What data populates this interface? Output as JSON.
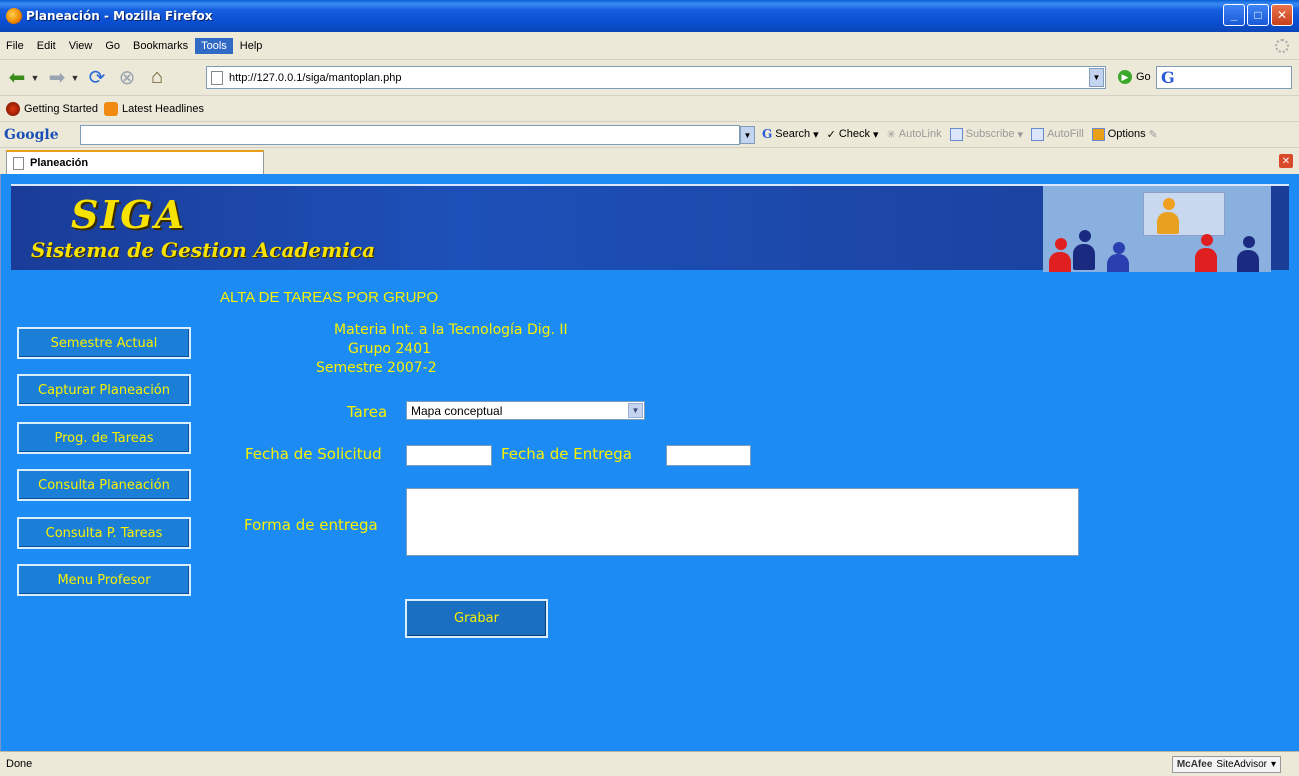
{
  "window": {
    "title": "Planeación - Mozilla Firefox"
  },
  "menubar": {
    "items": [
      "File",
      "Edit",
      "View",
      "Go",
      "Bookmarks",
      "Tools",
      "Help"
    ]
  },
  "navbar": {
    "url": "http://127.0.0.1/siga/mantoplan.php",
    "go_label": "Go"
  },
  "bookmarks": {
    "items": [
      "Getting Started",
      "Latest Headlines"
    ]
  },
  "googlebar": {
    "logo": "Google",
    "tools": [
      "Search",
      "Check",
      "AutoLink",
      "Subscribe",
      "AutoFill",
      "Options"
    ]
  },
  "tab": {
    "label": "Planeación"
  },
  "banner": {
    "logo": "SIGA",
    "subtitle": "Sistema de Gestion Academica"
  },
  "page": {
    "heading": "ALTA DE TAREAS POR GRUPO",
    "materia": "Materia Int. a la Tecnología Dig. II",
    "grupo": "Grupo 2401",
    "semestre": "Semestre 2007-2"
  },
  "sidebar": {
    "buttons": [
      "Semestre Actual",
      "Capturar Planeación",
      "Prog. de Tareas",
      "Consulta  Planeación",
      "Consulta P. Tareas",
      "Menu Profesor"
    ]
  },
  "form": {
    "tarea_label": "Tarea",
    "tarea_value": "Mapa conceptual",
    "fecha_solicitud_label": "Fecha de Solicitud",
    "fecha_solicitud_value": "",
    "fecha_entrega_label": "Fecha de Entrega",
    "fecha_entrega_value": "",
    "forma_entrega_label": "Forma de entrega",
    "forma_entrega_value": "",
    "submit_label": "Grabar"
  },
  "statusbar": {
    "status": "Done",
    "addon_brand": "McAfee",
    "addon_name": "SiteAdvisor"
  },
  "colors": {
    "content_background": "#1c8cf4",
    "accent_text": "#f8f000",
    "banner": "#1a3c98"
  }
}
